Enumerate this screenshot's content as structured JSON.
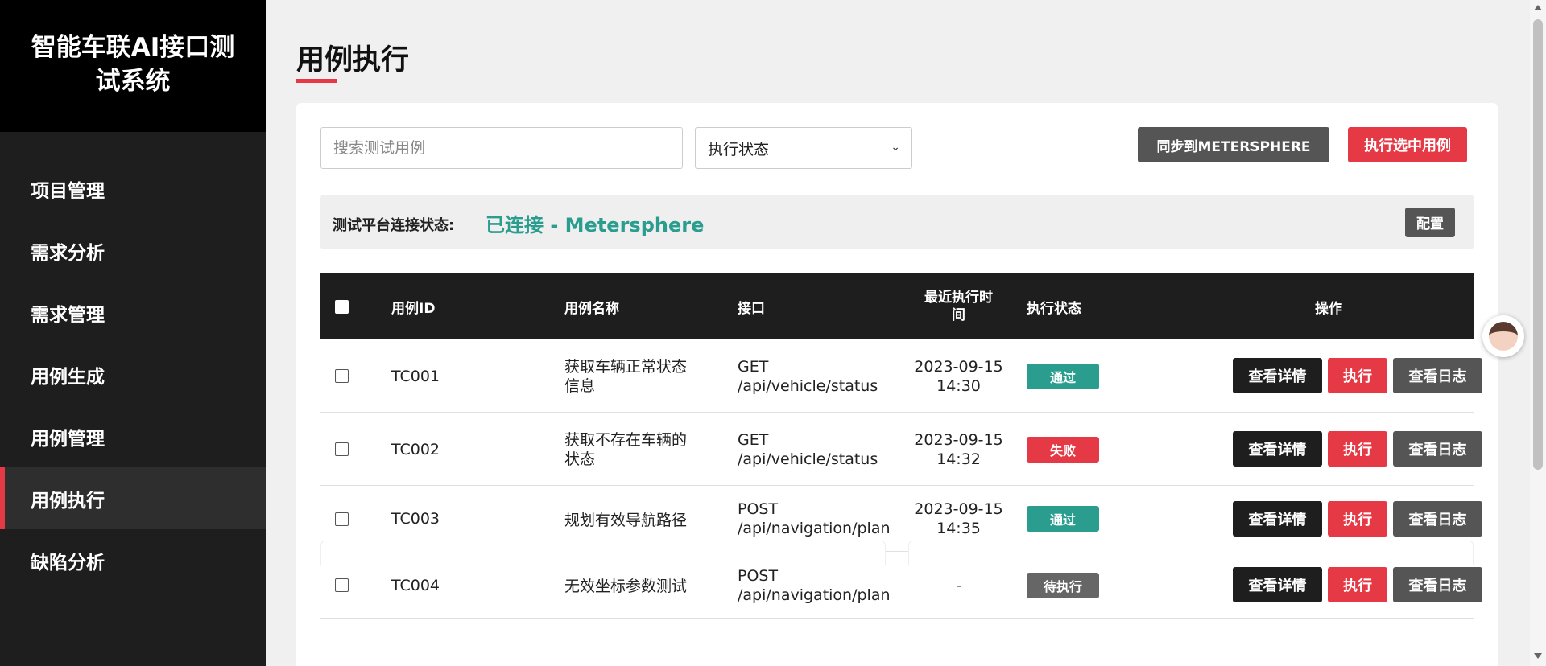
{
  "sidebar": {
    "title": "智能车联AI接口测试系统",
    "items": [
      {
        "label": "项目管理"
      },
      {
        "label": "需求分析"
      },
      {
        "label": "需求管理"
      },
      {
        "label": "用例生成"
      },
      {
        "label": "用例管理"
      },
      {
        "label": "用例执行",
        "active": true
      },
      {
        "label": "缺陷分析"
      }
    ]
  },
  "page": {
    "title": "用例执行"
  },
  "toolbar": {
    "search_placeholder": "搜索测试用例",
    "status_select_value": "执行状态",
    "sync_label": "同步到METERSPHERE",
    "execute_selected_label": "执行选中用例"
  },
  "connection": {
    "label": "测试平台连接状态:",
    "status": "已连接 - Metersphere",
    "config_label": "配置"
  },
  "table": {
    "headers": {
      "id": "用例ID",
      "name": "用例名称",
      "api": "接口",
      "last_run_line1": "最近执行时",
      "last_run_line2": "间",
      "status": "执行状态",
      "actions": "操作"
    },
    "rows": [
      {
        "id": "TC001",
        "name_line1": "获取车辆正常状态",
        "name_line2": "信息",
        "method": "GET",
        "path": "/api/vehicle/status",
        "date": "2023-09-15",
        "time": "14:30",
        "status": "通过",
        "status_color": "#2a9d8f"
      },
      {
        "id": "TC002",
        "name_line1": "获取不存在车辆的",
        "name_line2": "状态",
        "method": "GET",
        "path": "/api/vehicle/status",
        "date": "2023-09-15",
        "time": "14:32",
        "status": "失败",
        "status_color": "#e63946"
      },
      {
        "id": "TC003",
        "name_line1": "规划有效导航路径",
        "name_line2": "",
        "method": "POST",
        "path": "/api/navigation/plan",
        "date": "2023-09-15",
        "time": "14:35",
        "status": "通过",
        "status_color": "#2a9d8f"
      },
      {
        "id": "TC004",
        "name_line1": "无效坐标参数测试",
        "name_line2": "",
        "method": "POST",
        "path": "/api/navigation/plan",
        "date": "-",
        "time": "",
        "status": "待执行",
        "status_color": "#666666"
      }
    ],
    "action_labels": {
      "detail": "查看详情",
      "run": "执行",
      "log": "查看日志"
    }
  },
  "colors": {
    "accent": "#e63946",
    "success": "#2a9d8f",
    "sidebar": "#1e1e1e"
  }
}
